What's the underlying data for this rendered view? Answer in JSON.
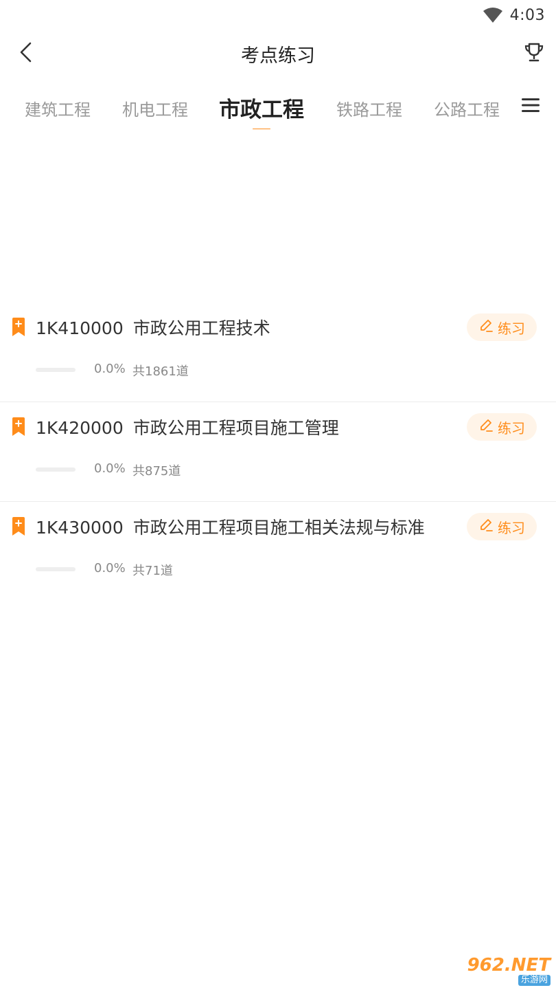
{
  "status_bar": {
    "time": "4:03",
    "wifi_icon": "wifi-icon"
  },
  "header": {
    "title": "考点练习",
    "back_icon": "back-arrow-icon",
    "trophy_icon": "trophy-icon"
  },
  "tabs": [
    {
      "label": "建筑工程",
      "active": false
    },
    {
      "label": "机电工程",
      "active": false
    },
    {
      "label": "市政工程",
      "active": true
    },
    {
      "label": "铁路工程",
      "active": false
    },
    {
      "label": "公路工程",
      "active": false
    }
  ],
  "accent_color": "#ff8c1a",
  "items": [
    {
      "code": "1K410000",
      "name": "市政公用工程技术",
      "progress": "0.0%",
      "count": "共1861道",
      "button": "练习"
    },
    {
      "code": "1K420000",
      "name": "市政公用工程项目施工管理",
      "progress": "0.0%",
      "count": "共875道",
      "button": "练习"
    },
    {
      "code": "1K430000",
      "name": "市政公用工程项目施工相关法规与标准",
      "progress": "0.0%",
      "count": "共71道",
      "button": "练习"
    }
  ],
  "watermark": {
    "main": "962.NET",
    "sub": "乐游网"
  }
}
